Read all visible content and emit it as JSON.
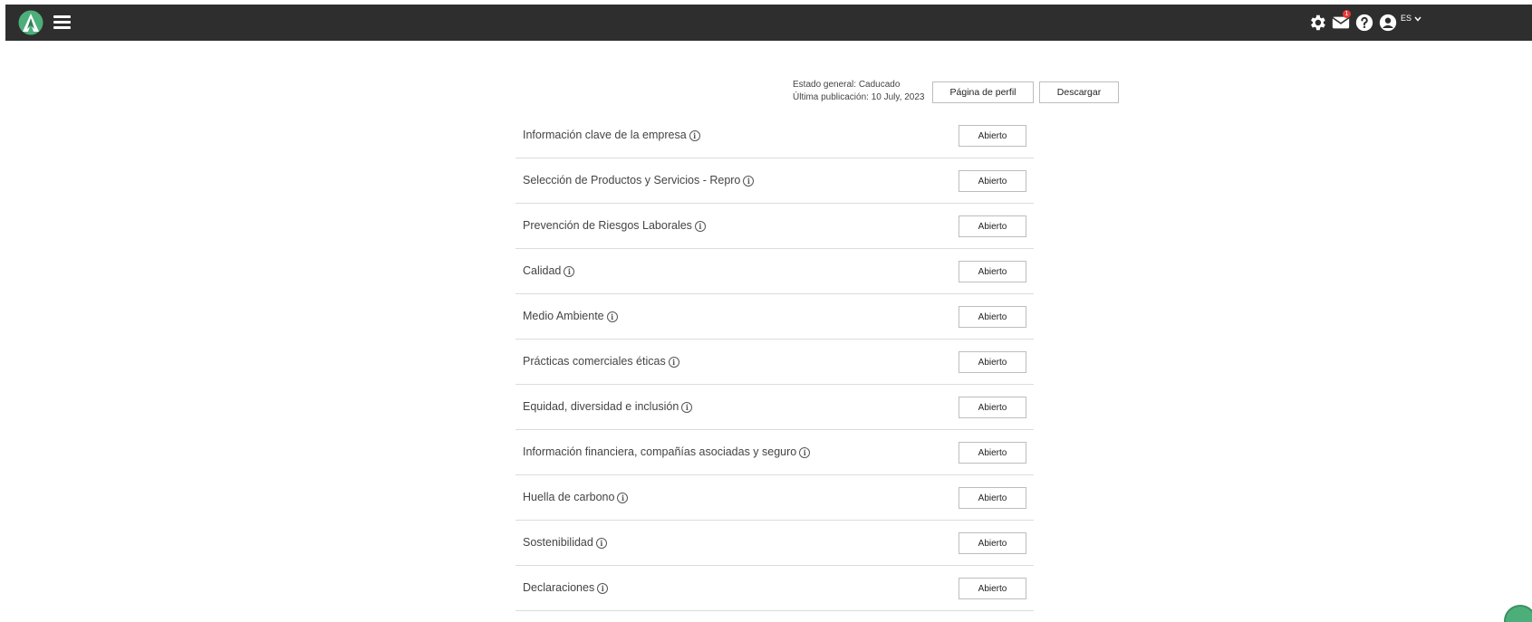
{
  "topbar": {
    "mail_badge": "1",
    "language": "ES",
    "icons": [
      "logo",
      "menu-icon",
      "gear-icon",
      "mail-icon",
      "help-icon",
      "user-icon",
      "chevron-down-icon"
    ],
    "background": "#2e2e2e"
  },
  "status": {
    "general": "Estado general: Caducado",
    "published": "Última publicación: 10 July, 2023"
  },
  "actions": {
    "profile_label": "Página de perfil",
    "download_label": "Descargar"
  },
  "sections": [
    {
      "label": "Información clave de la empresa",
      "button": "Abierto"
    },
    {
      "label": "Selección de Productos y Servicios - Repro",
      "button": "Abierto"
    },
    {
      "label": "Prevención de Riesgos Laborales",
      "button": "Abierto"
    },
    {
      "label": "Calidad",
      "button": "Abierto"
    },
    {
      "label": "Medio Ambiente",
      "button": "Abierto"
    },
    {
      "label": "Prácticas comerciales éticas",
      "button": "Abierto"
    },
    {
      "label": "Equidad, diversidad e inclusión",
      "button": "Abierto"
    },
    {
      "label": "Información financiera, compañías asociadas y seguro",
      "button": "Abierto"
    },
    {
      "label": "Huella de carbono",
      "button": "Abierto"
    },
    {
      "label": "Sostenibilidad",
      "button": "Abierto"
    },
    {
      "label": "Declaraciones",
      "button": "Abierto"
    }
  ],
  "info_glyph": "i",
  "colors": {
    "brand": "#4caf7a",
    "badge": "#e53935"
  }
}
